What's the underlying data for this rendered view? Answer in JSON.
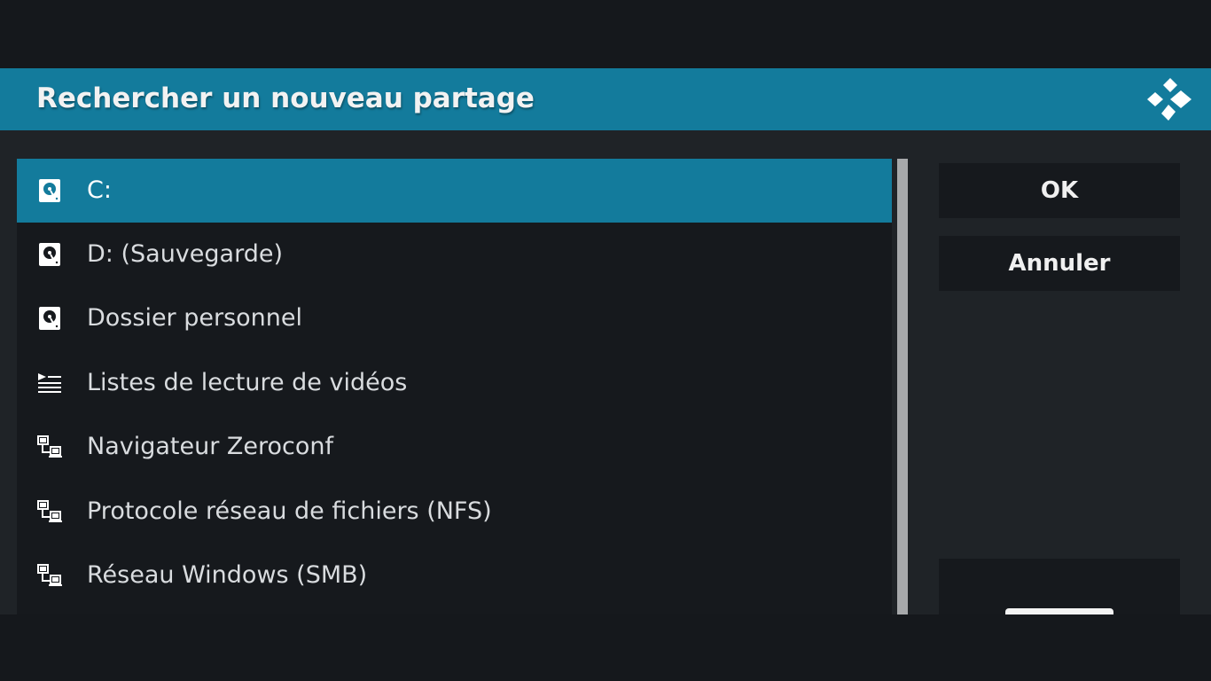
{
  "dialog": {
    "title": "Rechercher un nouveau partage",
    "logo_icon": "kodi-logo-icon"
  },
  "list": {
    "selected_index": 0,
    "items": [
      {
        "label": "C:",
        "icon": "hard-drive-icon"
      },
      {
        "label": "D: (Sauvegarde)",
        "icon": "hard-drive-icon"
      },
      {
        "label": "Dossier personnel",
        "icon": "hard-drive-icon"
      },
      {
        "label": "Listes de lecture de vidéos",
        "icon": "playlist-icon"
      },
      {
        "label": "Navigateur Zeroconf",
        "icon": "network-icon"
      },
      {
        "label": "Protocole réseau de fichiers (NFS)",
        "icon": "network-icon"
      },
      {
        "label": "Réseau Windows (SMB)",
        "icon": "network-icon"
      }
    ]
  },
  "buttons": {
    "ok_label": "OK",
    "cancel_label": "Annuler"
  },
  "colors": {
    "accent": "#137b9c",
    "panel": "#16191d",
    "background": "#1f2327"
  }
}
